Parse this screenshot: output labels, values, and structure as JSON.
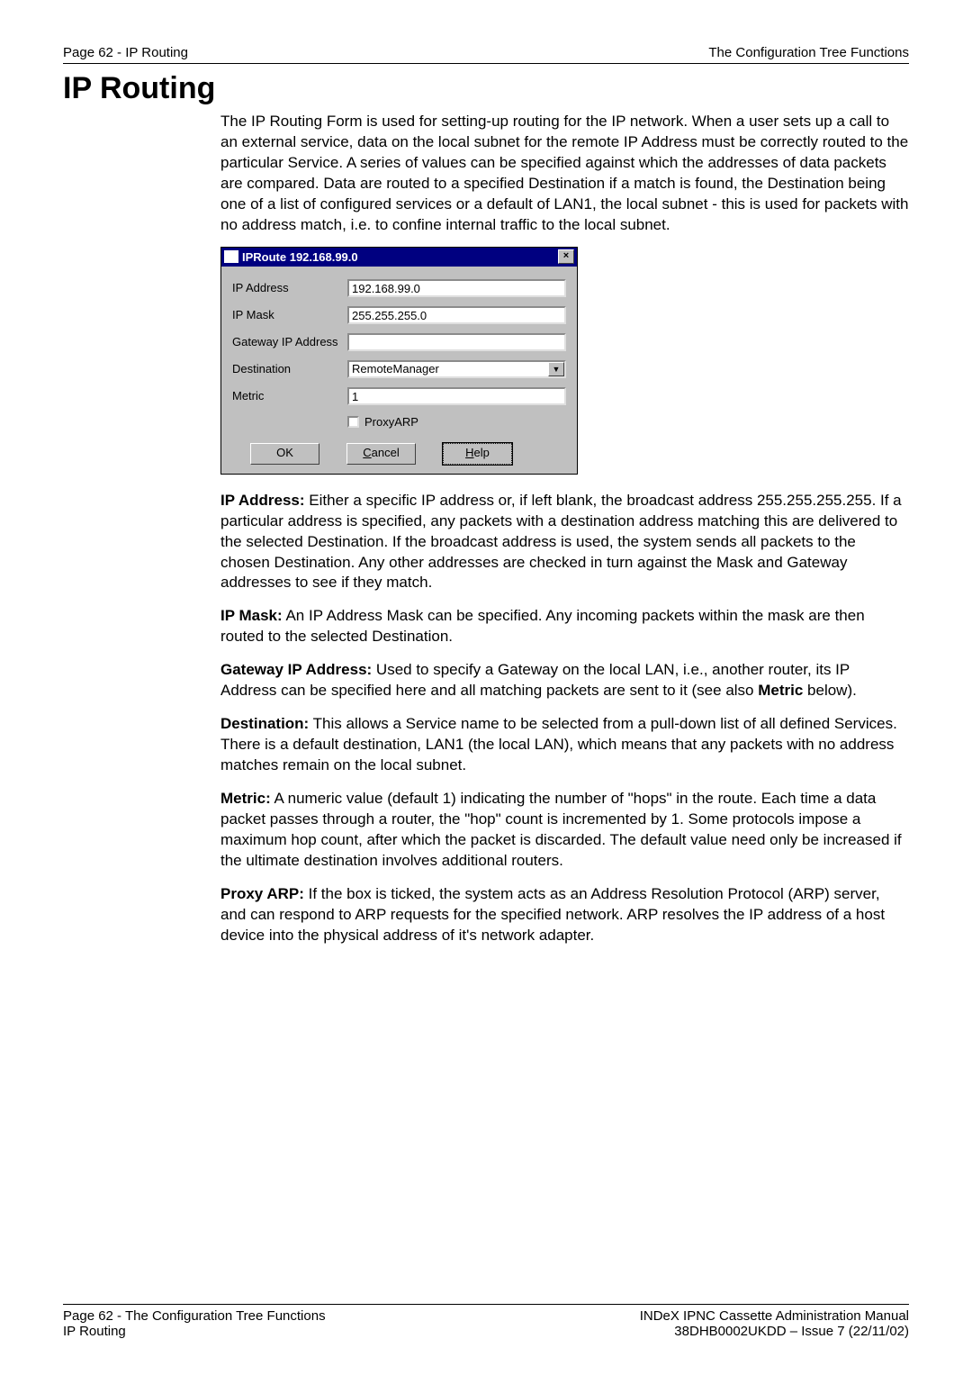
{
  "header": {
    "left": "Page 62 - IP Routing",
    "right": "The Configuration Tree Functions"
  },
  "title": "IP Routing",
  "intro": "The IP Routing Form is used for setting-up routing for the IP network. When a user sets up a call to an external service, data on the local subnet for the remote IP Address must be correctly routed to the particular Service. A series of values can be specified against which the addresses of data packets are compared. Data are routed to a specified Destination if a match is found, the Destination being one of a list of configured services or a default of LAN1, the local subnet - this is used for packets with no address match, i.e. to confine internal traffic to the local subnet.",
  "dialog": {
    "title": "IPRoute 192.168.99.0",
    "fields": {
      "ip_address_label": "IP Address",
      "ip_address_value": "192.168.99.0",
      "ip_mask_label": "IP Mask",
      "ip_mask_value": "255.255.255.0",
      "gateway_label": "Gateway IP Address",
      "gateway_value": "",
      "destination_label": "Destination",
      "destination_value": "RemoteManager",
      "metric_label": "Metric",
      "metric_value": "1",
      "proxyarp_label": "ProxyARP"
    },
    "buttons": {
      "ok": "OK",
      "cancel": "Cancel",
      "help": "Help"
    }
  },
  "descriptions": {
    "ip_address": {
      "label": "IP Address:",
      "text": " Either a specific IP address or, if left blank, the broadcast address 255.255.255.255. If a particular address is specified, any packets with a destination address matching this are delivered to the selected Destination. If the broadcast address is used, the system sends all packets to the chosen Destination. Any other addresses are checked in turn against the Mask and Gateway addresses to see if they match."
    },
    "ip_mask": {
      "label": "IP Mask:",
      "text": " An IP Address Mask can be specified. Any incoming packets within the mask are then routed to the selected Destination."
    },
    "gateway": {
      "label": "Gateway IP Address:",
      "text_before": " Used to specify a Gateway on the local LAN, i.e., another router, its IP Address can be specified here and all matching packets are sent to it (see also ",
      "bold_inline": "Metric",
      "text_after": " below)."
    },
    "destination": {
      "label": "Destination:",
      "text": " This allows a Service name to be selected from a pull-down list of all defined Services. There is a default destination, LAN1 (the local LAN), which means that any packets with no address matches remain on the local subnet."
    },
    "metric": {
      "label": "Metric:",
      "text": " A numeric value (default 1) indicating the number of \"hops\" in the route. Each time a data packet passes through a router, the \"hop\" count is incremented by 1. Some protocols impose a maximum hop count, after which the packet is discarded. The default value need only be increased if the ultimate destination involves additional routers."
    },
    "proxyarp": {
      "label": "Proxy ARP:",
      "text": " If the box is ticked, the system acts as an Address Resolution Protocol (ARP) server, and can respond to ARP requests for the specified network. ARP resolves the IP address of a host device into the physical address of it's network adapter."
    }
  },
  "footer": {
    "left_line1": "Page 62 - The Configuration Tree Functions",
    "left_line2": "IP Routing",
    "right_line1": "INDeX IPNC Cassette Administration Manual",
    "right_line2": "38DHB0002UKDD – Issue 7 (22/11/02)"
  }
}
